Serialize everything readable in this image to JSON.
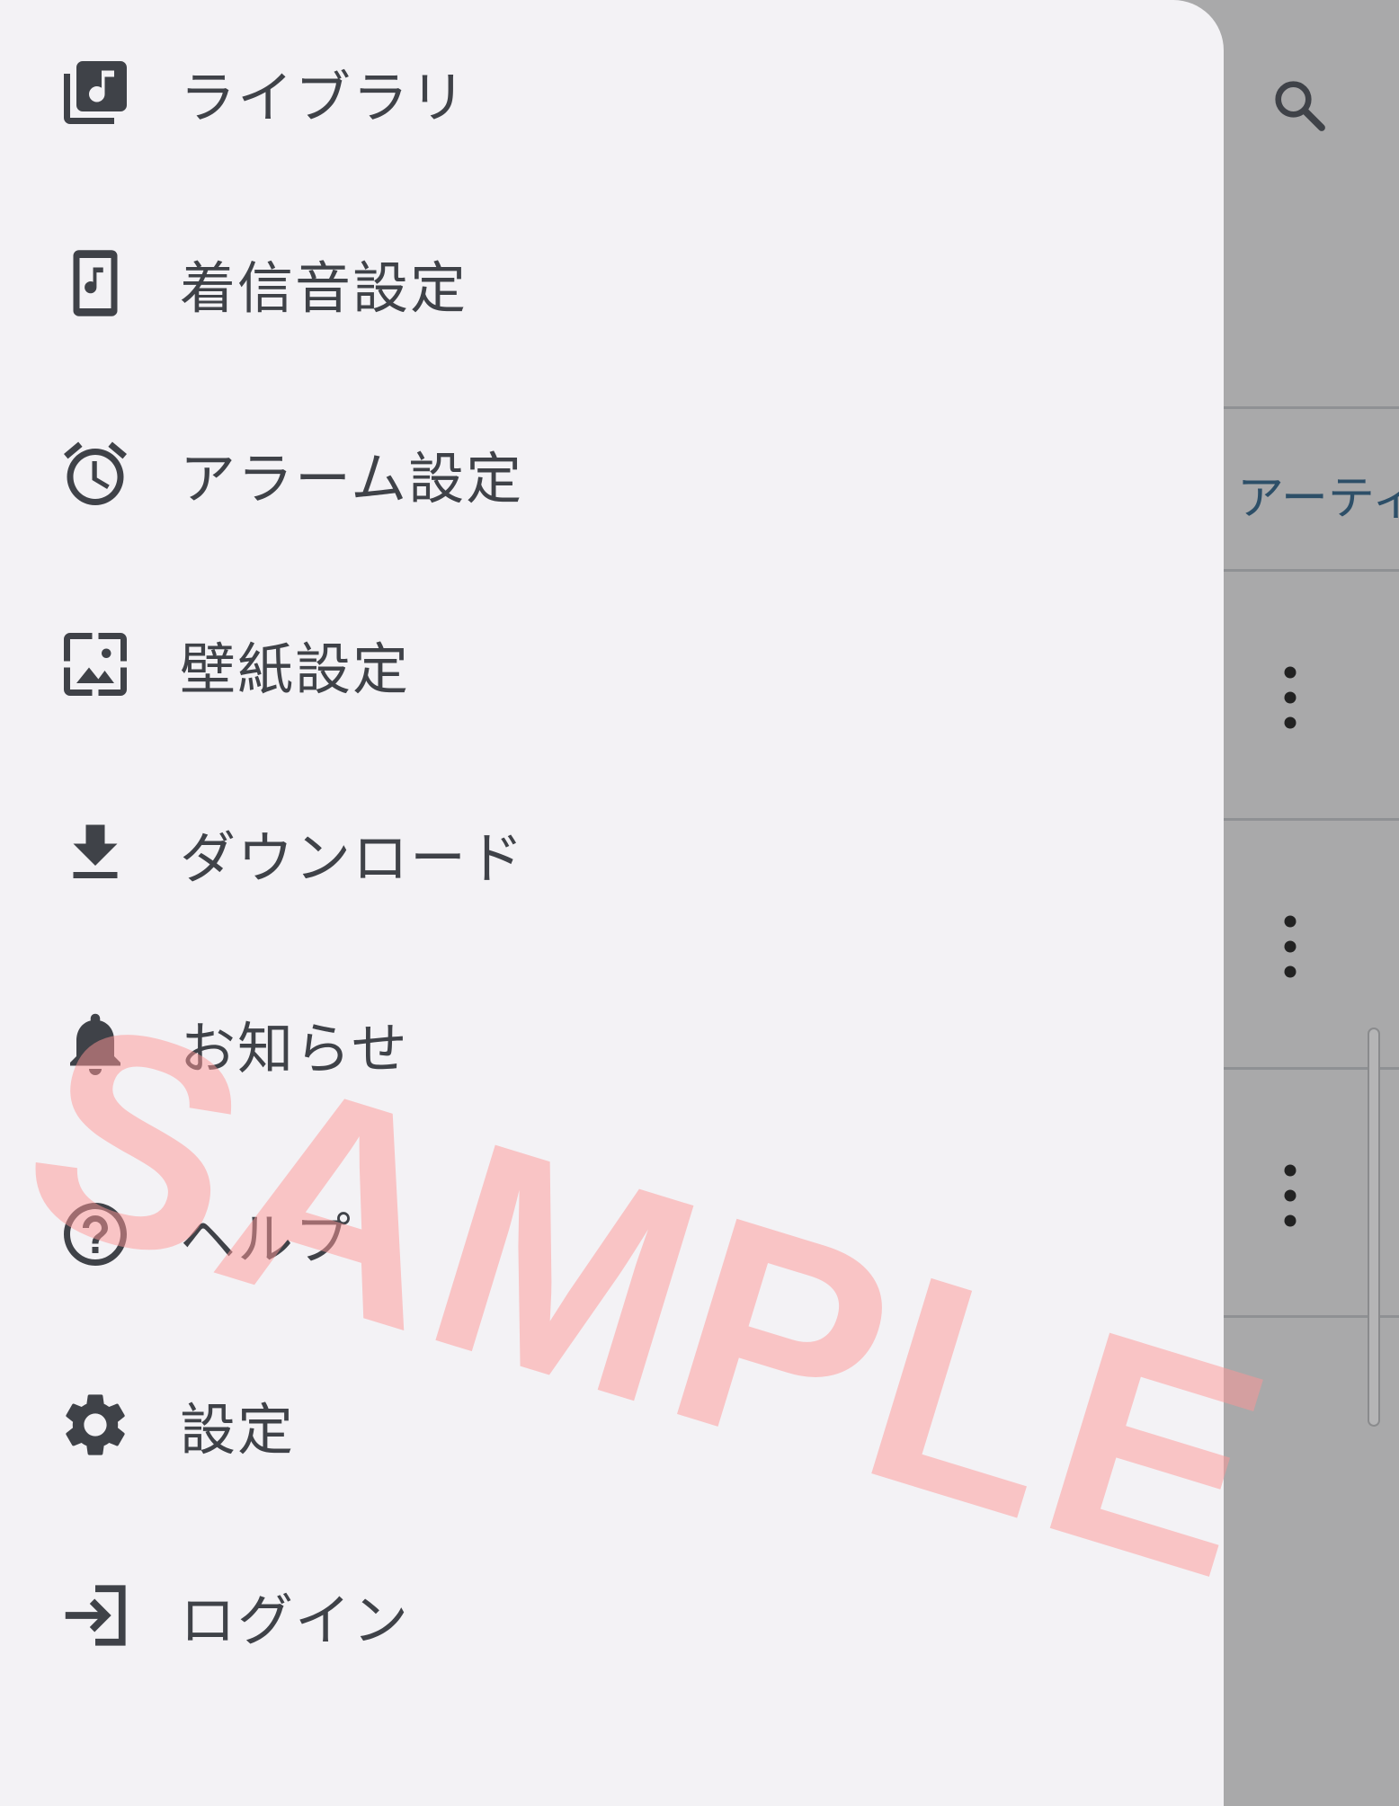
{
  "drawer": {
    "items": [
      {
        "label": "ライブラリ",
        "icon": "library-music-icon"
      },
      {
        "label": "着信音設定",
        "icon": "ringtone-phone-icon"
      },
      {
        "label": "アラーム設定",
        "icon": "alarm-clock-icon"
      },
      {
        "label": "壁紙設定",
        "icon": "wallpaper-icon"
      },
      {
        "label": "ダウンロード",
        "icon": "download-icon"
      },
      {
        "label": "お知らせ",
        "icon": "bell-icon"
      },
      {
        "label": "ヘルプ",
        "icon": "help-icon"
      },
      {
        "label": "設定",
        "icon": "gear-icon"
      },
      {
        "label": "ログイン",
        "icon": "login-icon"
      }
    ]
  },
  "background_app": {
    "tab_label": "アーティ",
    "search_icon": "search-icon",
    "row_action_icon": "more-vert-icon"
  },
  "watermark": {
    "text": "SAMPLE"
  },
  "colors": {
    "drawer_bg": "#f3f2f5",
    "icon": "#3f4248",
    "scrim": "#a9a9aa",
    "tab_text": "#2d4f68",
    "watermark": "#ff9696"
  }
}
